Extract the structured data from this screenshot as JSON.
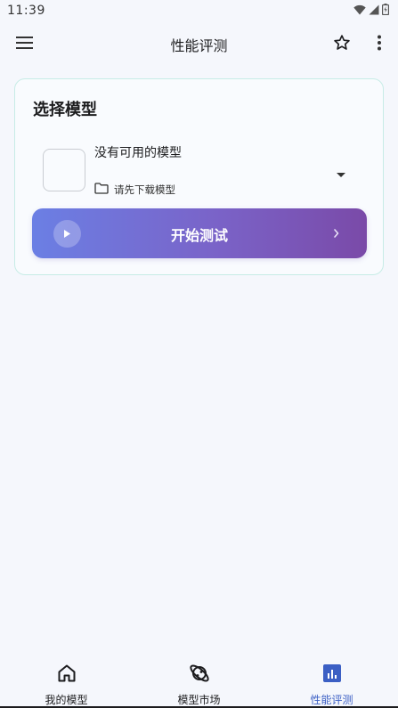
{
  "status_bar": {
    "time": "11:39"
  },
  "app_bar": {
    "title": "性能评测"
  },
  "card": {
    "title": "选择模型",
    "model_name": "没有可用的模型",
    "model_hint": "请先下载模型",
    "start_button_label": "开始测试"
  },
  "bottom_nav": {
    "items": [
      {
        "label": "我的模型",
        "icon": "home-icon",
        "active": false
      },
      {
        "label": "模型市场",
        "icon": "planet-icon",
        "active": false
      },
      {
        "label": "性能评测",
        "icon": "bar-chart-icon",
        "active": true
      }
    ]
  },
  "colors": {
    "accent": "#3b5fc4",
    "gradient_start": "#6b7fe4",
    "gradient_end": "#7a4aa8",
    "card_border": "#c7ece6",
    "background": "#f5f7fc"
  }
}
